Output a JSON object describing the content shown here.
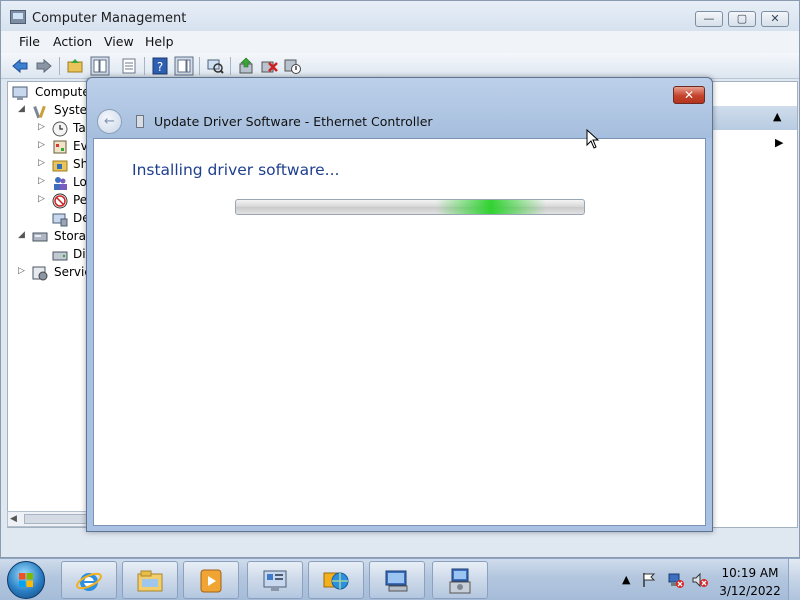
{
  "app": {
    "title": "Computer Management"
  },
  "menu": [
    {
      "label": "File"
    },
    {
      "label": "Action"
    },
    {
      "label": "View"
    },
    {
      "label": "Help"
    }
  ],
  "tree": [
    {
      "label": "Computer",
      "expander": "",
      "icon": "computer-icon"
    },
    {
      "label": "System",
      "expander": "◢",
      "icon": "tools-icon"
    },
    {
      "label": "Ta",
      "expander": "▷",
      "icon": "clock-icon"
    },
    {
      "label": "Eve",
      "expander": "▷",
      "icon": "event-viewer-icon"
    },
    {
      "label": "Sha",
      "expander": "▷",
      "icon": "shared-folder-icon"
    },
    {
      "label": "Loc",
      "expander": "▷",
      "icon": "users-icon"
    },
    {
      "label": "Pe",
      "expander": "▷",
      "icon": "performance-icon"
    },
    {
      "label": "De",
      "expander": "",
      "icon": "device-manager-icon"
    },
    {
      "label": "Storag",
      "expander": "◢",
      "icon": "storage-icon"
    },
    {
      "label": "Dis",
      "expander": "",
      "icon": "disk-icon"
    },
    {
      "label": "Service",
      "expander": "▷",
      "icon": "services-icon"
    }
  ],
  "dialog": {
    "title": "Update Driver Software - Ethernet Controller",
    "heading": "Installing driver software...",
    "close_glyph": "✕",
    "back_glyph": "←"
  },
  "clock": {
    "time": "10:19 AM",
    "date": "3/12/2022"
  },
  "colors": {
    "accent": "#1f3f8f",
    "progress_glow": "#28d228",
    "close_button": "#c5422b"
  }
}
